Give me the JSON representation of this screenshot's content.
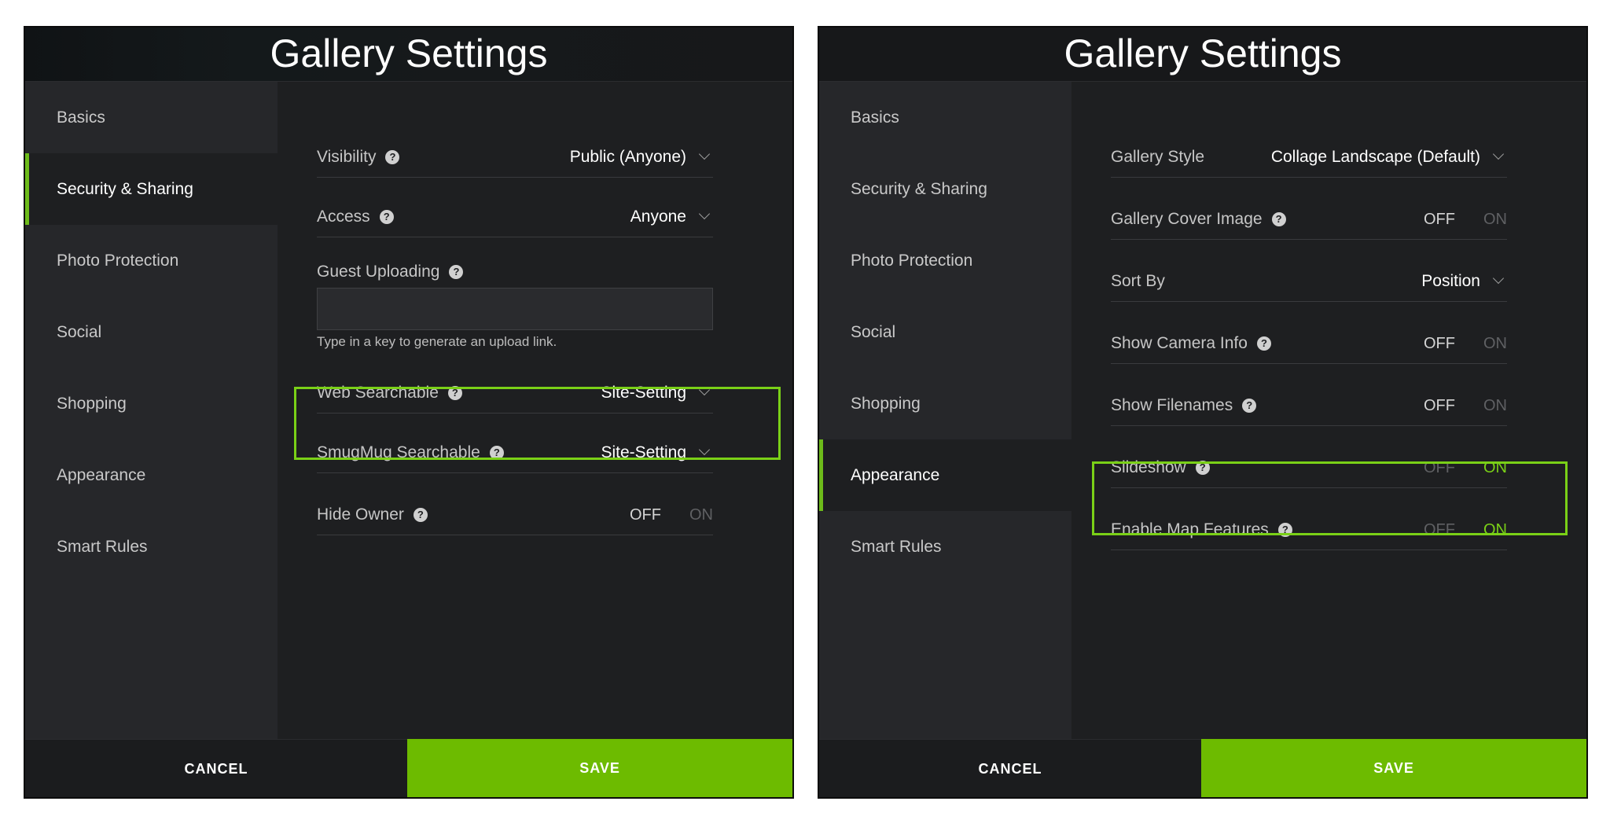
{
  "left": {
    "title": "Gallery Settings",
    "nav": [
      "Basics",
      "Security & Sharing",
      "Photo Protection",
      "Social",
      "Shopping",
      "Appearance",
      "Smart Rules"
    ],
    "active_nav": "Security & Sharing",
    "settings": {
      "visibility": {
        "label": "Visibility",
        "value": "Public (Anyone)"
      },
      "access": {
        "label": "Access",
        "value": "Anyone"
      },
      "guest_uploading": {
        "label": "Guest Uploading",
        "value": "",
        "hint": "Type in a key to generate an upload link."
      },
      "web_searchable": {
        "label": "Web Searchable",
        "value": "Site-Setting"
      },
      "smugmug_searchable": {
        "label": "SmugMug Searchable",
        "value": "Site-Setting"
      },
      "hide_owner": {
        "label": "Hide Owner",
        "off": "OFF",
        "on": "ON",
        "state": "OFF"
      }
    },
    "cancel_label": "CANCEL",
    "save_label": "SAVE"
  },
  "right": {
    "title": "Gallery Settings",
    "nav": [
      "Basics",
      "Security & Sharing",
      "Photo Protection",
      "Social",
      "Shopping",
      "Appearance",
      "Smart Rules"
    ],
    "active_nav": "Appearance",
    "settings": {
      "gallery_style": {
        "label": "Gallery Style",
        "value": "Collage Landscape (Default)"
      },
      "gallery_cover_image": {
        "label": "Gallery Cover Image",
        "off": "OFF",
        "on": "ON",
        "state": "OFF"
      },
      "sort_by": {
        "label": "Sort By",
        "value": "Position"
      },
      "show_camera_info": {
        "label": "Show Camera Info",
        "off": "OFF",
        "on": "ON",
        "state": "OFF"
      },
      "show_filenames": {
        "label": "Show Filenames",
        "off": "OFF",
        "on": "ON",
        "state": "OFF"
      },
      "slideshow": {
        "label": "Slideshow",
        "off": "OFF",
        "on": "ON",
        "state": "ON"
      },
      "enable_map_features": {
        "label": "Enable Map Features",
        "off": "OFF",
        "on": "ON",
        "state": "ON"
      }
    },
    "cancel_label": "CANCEL",
    "save_label": "SAVE"
  },
  "help_glyph": "?",
  "colors": {
    "accent": "#6dbb00",
    "highlight": "#7ad017",
    "panel_bg": "#1e1f21",
    "sidebar_bg": "#26272a"
  }
}
